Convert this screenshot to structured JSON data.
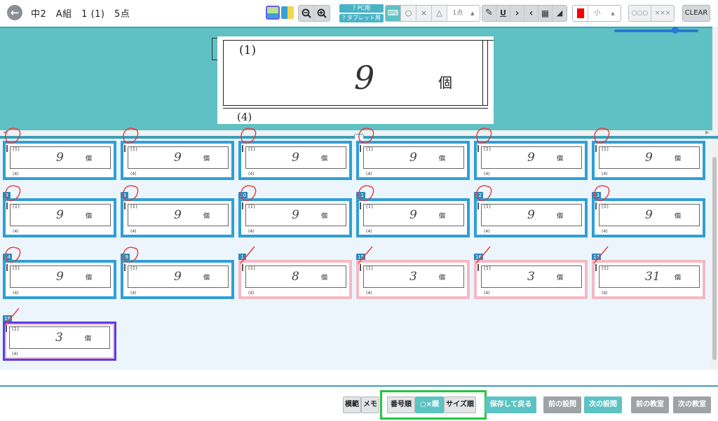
{
  "header": {
    "title": "中2　A組　1 (1)　5点",
    "pc_label": "PC用",
    "tablet_label": "タブレット用",
    "marks": [
      "○",
      "×",
      "△"
    ],
    "score_select": "1点",
    "pen_size": "小",
    "stamp_circles": "○○○",
    "stamp_crosses": "×××",
    "clear_label": "CLEAR",
    "pen_color": "#ff0000"
  },
  "preview": {
    "question_label": "(1)",
    "answer": "9",
    "unit": "個",
    "next_label": "(4)"
  },
  "grid": {
    "cells": [
      {
        "num": "",
        "answer": "9",
        "status": "correct"
      },
      {
        "num": "",
        "answer": "9",
        "status": "correct"
      },
      {
        "num": "",
        "answer": "9",
        "status": "correct"
      },
      {
        "num": "",
        "answer": "9",
        "status": "correct"
      },
      {
        "num": "",
        "answer": "9",
        "status": "correct"
      },
      {
        "num": "",
        "answer": "9",
        "status": "correct"
      },
      {
        "num": "8",
        "answer": "9",
        "status": "correct"
      },
      {
        "num": "9",
        "answer": "9",
        "status": "correct"
      },
      {
        "num": "10",
        "answer": "9",
        "status": "correct"
      },
      {
        "num": "11",
        "answer": "9",
        "status": "correct"
      },
      {
        "num": "12",
        "answer": "9",
        "status": "correct"
      },
      {
        "num": "13",
        "answer": "9",
        "status": "correct"
      },
      {
        "num": "14",
        "answer": "9",
        "status": "correct"
      },
      {
        "num": "19",
        "answer": "9",
        "status": "correct"
      },
      {
        "num": "1",
        "answer": "8",
        "status": "wrong"
      },
      {
        "num": "15",
        "answer": "3",
        "status": "wrong"
      },
      {
        "num": "16",
        "answer": "3",
        "status": "wrong"
      },
      {
        "num": "17",
        "answer": "31",
        "status": "wrong"
      },
      {
        "num": "18",
        "answer": "3",
        "status": "wrong",
        "selected": true
      }
    ],
    "question_label": "(1)",
    "unit": "個",
    "next_label": "(4)"
  },
  "footer": {
    "model_answer": "模範",
    "memo": "メモ",
    "sort_number": "番号順",
    "sort_mark": "○×順",
    "sort_size": "サイズ順",
    "save_back": "保存して戻る",
    "prev_question": "前の設問",
    "next_question": "次の設問",
    "prev_class": "前の教室",
    "next_class": "次の教室"
  },
  "colors": {
    "accent": "#5fc1c3",
    "correct_border": "#2f9fd6",
    "wrong_border": "#f4b9c4",
    "selected_border": "#5a3ee8",
    "highlight": "#27c443"
  }
}
